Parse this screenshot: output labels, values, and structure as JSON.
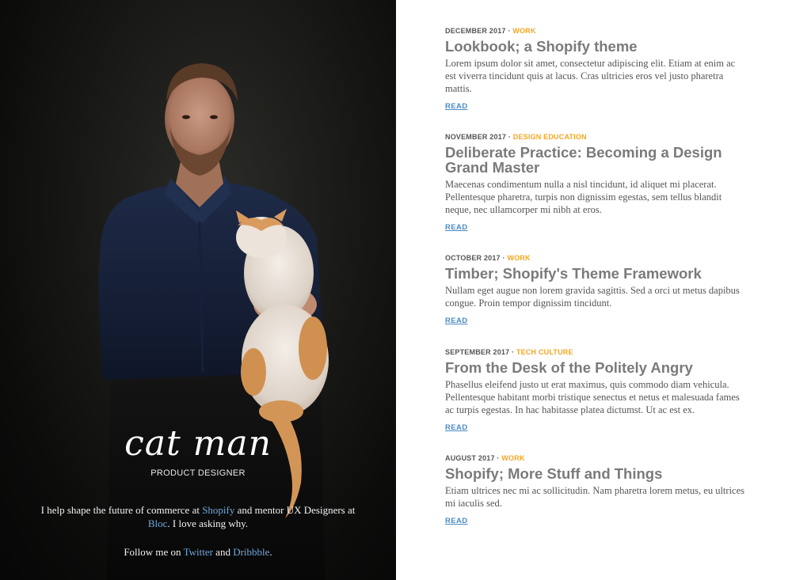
{
  "hero": {
    "name": "cat man",
    "role": "PRODUCT DESIGNER",
    "bio_before_shopify": "I help shape the future of commerce at ",
    "shopify_link": "Shopify",
    "bio_middle": " and mentor UX Designers at ",
    "bloc_link": "Bloc",
    "bio_after": ". I love asking why.",
    "follow_before": "Follow me on ",
    "twitter_link": "Twitter",
    "follow_and": " and ",
    "dribbble_link": "Dribbble",
    "follow_after": "."
  },
  "posts": [
    {
      "date": "DECEMBER 2017",
      "category": "WORK",
      "title": "Lookbook; a Shopify theme",
      "excerpt": "Lorem ipsum dolor sit amet, consectetur adipiscing elit. Etiam at enim ac est viverra tincidunt quis at lacus. Cras ultricies eros vel justo pharetra mattis.",
      "read": "READ"
    },
    {
      "date": "NOVEMBER 2017",
      "category": "DESIGN EDUCATION",
      "title": "Deliberate Practice: Becoming a Design Grand Master",
      "excerpt": "Maecenas condimentum nulla a nisl tincidunt, id aliquet mi placerat. Pellentesque pharetra, turpis non dignissim egestas, sem tellus blandit neque, nec ullamcorper mi nibh at eros.",
      "read": "READ"
    },
    {
      "date": "OCTOBER 2017",
      "category": "WORK",
      "title": "Timber; Shopify's Theme Framework",
      "excerpt": "Nullam eget augue non lorem gravida sagittis. Sed a orci ut metus dapibus congue. Proin tempor dignissim tincidunt.",
      "read": "READ"
    },
    {
      "date": "SEPTEMBER 2017",
      "category": "TECH CULTURE",
      "title": "From the Desk of the Politely Angry",
      "excerpt": "Phasellus eleifend justo ut erat maximus, quis commodo diam vehicula. Pellentesque habitant morbi tristique senectus et netus et malesuada fames ac turpis egestas. In hac habitasse platea dictumst. Ut ac est ex.",
      "read": "READ"
    },
    {
      "date": "AUGUST 2017",
      "category": "WORK",
      "title": "Shopify; More Stuff and Things",
      "excerpt": "Etiam ultrices nec mi ac sollicitudin. Nam pharetra lorem metus, eu ultrices mi iaculis sed.",
      "read": "READ"
    }
  ],
  "colors": {
    "category": "#f5a623",
    "link": "#4a8bc4",
    "title": "#7a7a7a"
  }
}
